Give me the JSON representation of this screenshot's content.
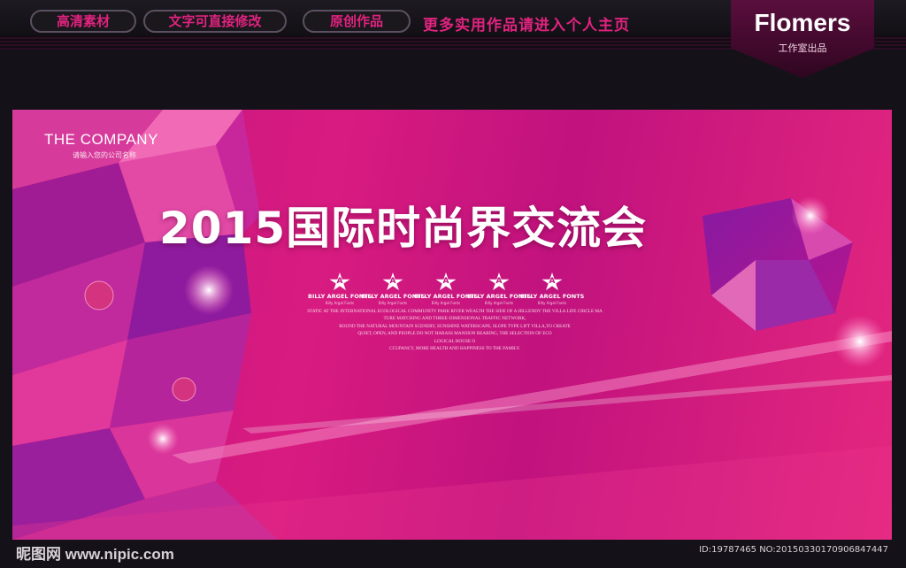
{
  "topbar": {
    "tags": [
      "高清素材",
      "文字可直接修改",
      "原创作品"
    ],
    "promo": "更多实用作品请进入个人主页",
    "brand": {
      "name": "Flomers",
      "subtitle": "工作室出品"
    }
  },
  "banner": {
    "company": "THE COMPANY",
    "company_sub": "请输入您的公司名称",
    "title": "2015国际时尚界交流会",
    "stars": [
      {
        "letter": "A",
        "label": "BILLY ARGEL FONTS",
        "script": "Billy Argel Fonts"
      },
      {
        "letter": "A",
        "label": "BILLY ARGEL FONTS",
        "script": "Billy Argel Fonts"
      },
      {
        "letter": "A",
        "label": "BILLY ARGEL FONTS",
        "script": "Billy Argel Fonts"
      },
      {
        "letter": "A",
        "label": "BILLY ARGEL FONTS",
        "script": "Billy Argel Fonts"
      },
      {
        "letter": "A",
        "label": "BILLY ARGEL FONTS",
        "script": "Billy Argel Fonts"
      }
    ],
    "paragraph": [
      "STATIC AT THE INTERNATIONAL ECOLOGICAL COMMUNITY PARK RIVER WEALTH THE SIDE OF A HILLENDY THE VILLA LIFE CIRCLE MA",
      "TURE MATCHING AND THREE-DIMENSIONAL TRAFFIC NETWORK,",
      "ROUND THE NATURAL MOUNTAIN SCENERY, SUNSHINE WATERSCAPE, SLOPE TYPE LIFT VILLA,TO CREATE",
      "QUIET, OPEN, AND PEOPLE DO NOT HARASS MANSION BEARING, THE SELECTION OF ECO",
      "LOGICAL HOUSE O",
      "CCUPANCY, MORE HEALTH AND HAPPINESS TO THE FAMILY."
    ]
  },
  "footer": {
    "site": "昵图网 www.nipic.com",
    "id_text": "ID:19787465 NO:20150330170906847447"
  },
  "colors": {
    "accent": "#e0237f",
    "banner": "#c2157e",
    "background": "#141218"
  }
}
